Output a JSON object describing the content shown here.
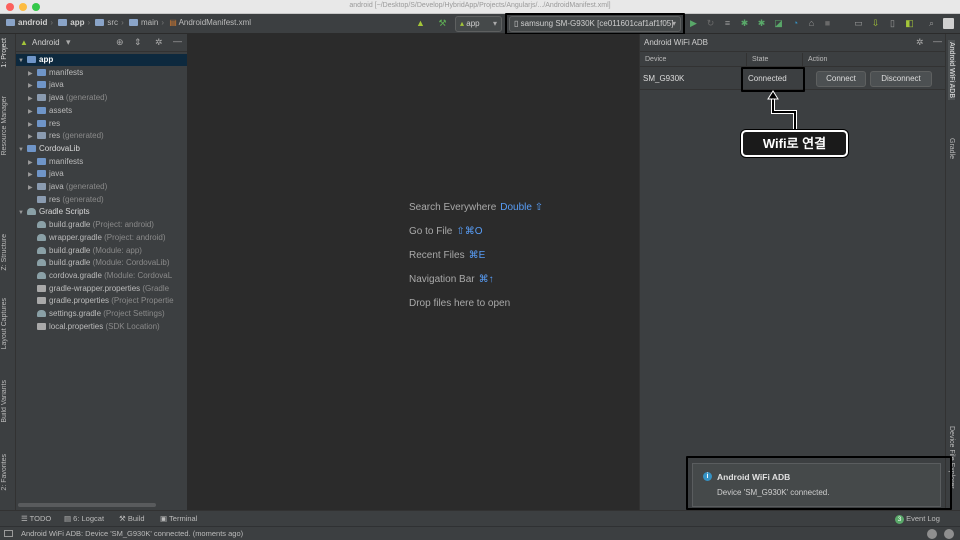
{
  "window": {
    "title": "android [~/Desktop/S/Develop/HybridApp/Projects/Angularjs/.../AndroidManifest.xml]",
    "traffic_lights": [
      "#fc615d",
      "#fdbc40",
      "#34c84a"
    ]
  },
  "breadcrumb": [
    "android",
    "app",
    "src",
    "main",
    "AndroidManifest.xml"
  ],
  "toolbar": {
    "run_config": "app",
    "device": "samsung SM-G930K [ce011601caf1af1f05]"
  },
  "left_tabs": [
    "1: Project",
    "Resource Manager",
    "Z: Structure",
    "Layout Captures",
    "Build Variants",
    "2: Favorites"
  ],
  "right_tabs": [
    "Android WiFi ADB",
    "Gradle",
    "Device File Explorer"
  ],
  "project": {
    "view": "Android",
    "tree": [
      {
        "label": "app",
        "extra": "",
        "level": 0,
        "expanded": true,
        "kind": "module",
        "selected": true
      },
      {
        "label": "manifests",
        "extra": "",
        "level": 1,
        "expanded": false,
        "kind": "folder"
      },
      {
        "label": "java",
        "extra": "",
        "level": 1,
        "expanded": false,
        "kind": "folder"
      },
      {
        "label": "java",
        "extra": "(generated)",
        "level": 1,
        "expanded": false,
        "kind": "folder-gen"
      },
      {
        "label": "assets",
        "extra": "",
        "level": 1,
        "expanded": false,
        "kind": "folder"
      },
      {
        "label": "res",
        "extra": "",
        "level": 1,
        "expanded": false,
        "kind": "folder"
      },
      {
        "label": "res",
        "extra": "(generated)",
        "level": 1,
        "expanded": false,
        "kind": "folder-gen"
      },
      {
        "label": "CordovaLib",
        "extra": "",
        "level": 0,
        "expanded": true,
        "kind": "module"
      },
      {
        "label": "manifests",
        "extra": "",
        "level": 1,
        "expanded": false,
        "kind": "folder"
      },
      {
        "label": "java",
        "extra": "",
        "level": 1,
        "expanded": false,
        "kind": "folder"
      },
      {
        "label": "java",
        "extra": "(generated)",
        "level": 1,
        "expanded": false,
        "kind": "folder-gen"
      },
      {
        "label": "res",
        "extra": "(generated)",
        "level": 1,
        "expanded": null,
        "kind": "folder-gen"
      },
      {
        "label": "Gradle Scripts",
        "extra": "",
        "level": 0,
        "expanded": true,
        "kind": "gradle"
      },
      {
        "label": "build.gradle",
        "extra": "(Project: android)",
        "level": 1,
        "expanded": null,
        "kind": "gradle"
      },
      {
        "label": "wrapper.gradle",
        "extra": "(Project: android)",
        "level": 1,
        "expanded": null,
        "kind": "gradle"
      },
      {
        "label": "build.gradle",
        "extra": "(Module: app)",
        "level": 1,
        "expanded": null,
        "kind": "gradle"
      },
      {
        "label": "build.gradle",
        "extra": "(Module: CordovaLib)",
        "level": 1,
        "expanded": null,
        "kind": "gradle"
      },
      {
        "label": "cordova.gradle",
        "extra": "(Module: CordovaL",
        "level": 1,
        "expanded": null,
        "kind": "gradle"
      },
      {
        "label": "gradle-wrapper.properties",
        "extra": "(Gradle",
        "level": 1,
        "expanded": null,
        "kind": "props"
      },
      {
        "label": "gradle.properties",
        "extra": "(Project Propertie",
        "level": 1,
        "expanded": null,
        "kind": "props"
      },
      {
        "label": "settings.gradle",
        "extra": "(Project Settings)",
        "level": 1,
        "expanded": null,
        "kind": "gradle"
      },
      {
        "label": "local.properties",
        "extra": "(SDK Location)",
        "level": 1,
        "expanded": null,
        "kind": "props"
      }
    ]
  },
  "editor": {
    "hints": [
      {
        "label": "Search Everywhere",
        "key": "Double ⇧"
      },
      {
        "label": "Go to File",
        "key": "⇧⌘O"
      },
      {
        "label": "Recent Files",
        "key": "⌘E"
      },
      {
        "label": "Navigation Bar",
        "key": "⌘↑"
      },
      {
        "label": "Drop files here to open",
        "key": ""
      }
    ]
  },
  "adb": {
    "title": "Android WiFi ADB",
    "columns": [
      "Device",
      "State",
      "Action"
    ],
    "rows": [
      {
        "device": "SM_G930K",
        "state": "Connected",
        "connect": "Connect",
        "disconnect": "Disconnect"
      }
    ]
  },
  "callout": {
    "text": "Wifi로 연결"
  },
  "notification": {
    "title": "Android WiFi ADB",
    "body": "Device 'SM_G930K' connected."
  },
  "bottom_tabs": [
    "TODO",
    "6: Logcat",
    "Build",
    "Terminal"
  ],
  "event_log": {
    "count": "3",
    "label": "Event Log"
  },
  "status": {
    "text": "Android WiFi ADB: Device 'SM_G930K' connected. (moments ago)"
  }
}
